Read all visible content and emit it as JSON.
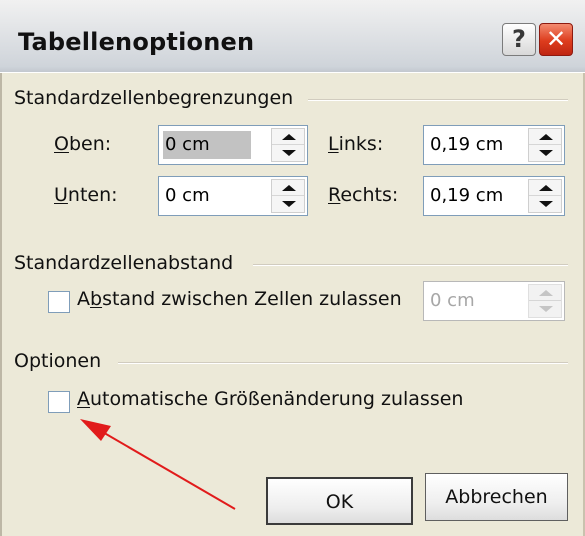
{
  "dialog": {
    "title": "Tabellenoptionen",
    "help_button_label": "?",
    "close_button_label": "✕",
    "accent_close": "#dd3c1d",
    "accent_bar": "#cfd4da"
  },
  "groups": {
    "cell_borders": {
      "title": "Standardzellenbegrenzungen",
      "fields": [
        {
          "label_mnemonic": "O",
          "label_rest": "ben:",
          "value": "0 cm"
        },
        {
          "label_mnemonic": "L",
          "label_rest": "inks:",
          "value": "0,19 cm"
        },
        {
          "label_mnemonic": "U",
          "label_rest": "nten:",
          "value": "0 cm"
        },
        {
          "label_mnemonic": "R",
          "label_rest": "echts:",
          "value": "0,19 cm"
        }
      ]
    },
    "cell_spacing": {
      "title": "Standardzellenabstand",
      "checkbox_label_prefix": "A",
      "checkbox_label_mnemonic": "b",
      "checkbox_label_rest": "stand zwischen Zellen zulassen",
      "checked": false,
      "spacing_value": "0 cm"
    },
    "options": {
      "title": "Optionen",
      "checkbox_label_mnemonic": "A",
      "checkbox_label_rest": "utomatische Größenänderung zulassen",
      "checked": false
    }
  },
  "buttons": {
    "ok_label": "OK",
    "cancel_label": "Abbrechen"
  },
  "annotation": {
    "arrow_color": "#e11b1b"
  }
}
